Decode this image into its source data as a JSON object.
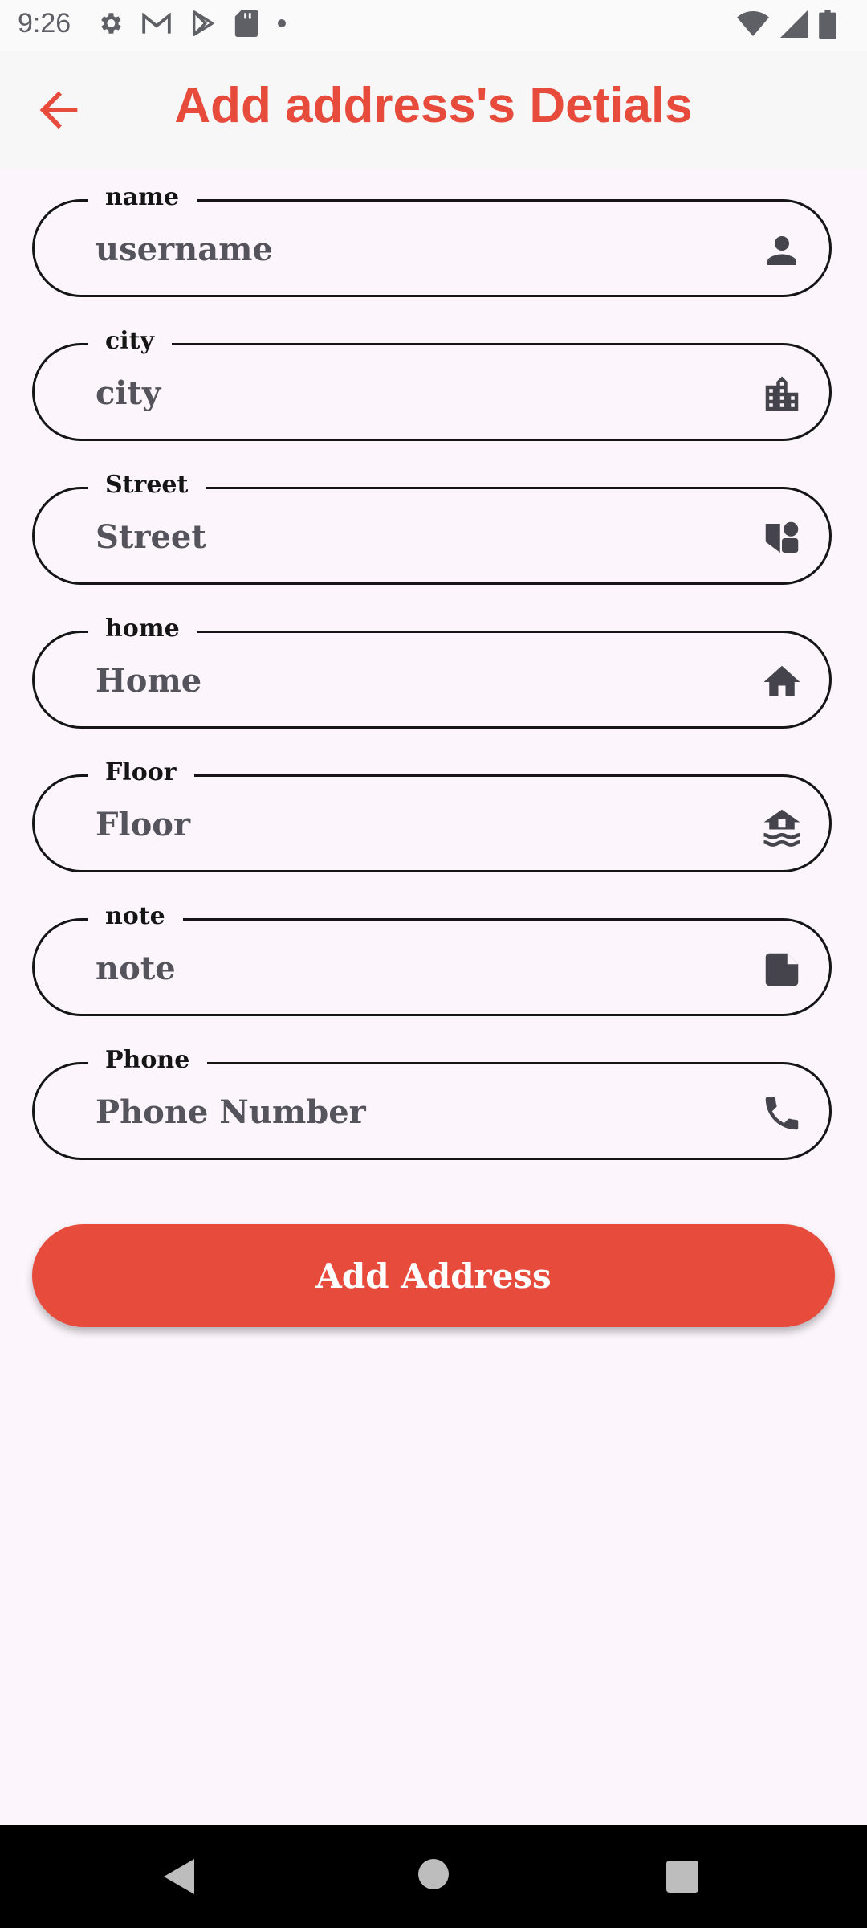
{
  "status_bar": {
    "time": "9:26",
    "left_icons": [
      "gear-icon",
      "gmail-icon",
      "play-store-icon",
      "sd-card-icon",
      "dot-icon"
    ],
    "right_icons": [
      "wifi-icon",
      "signal-icon",
      "battery-icon"
    ]
  },
  "app_bar": {
    "back_icon": "arrow-back-icon",
    "title": "Add address's Detials",
    "accent_color": "#e64b3c"
  },
  "fields": [
    {
      "label": "name",
      "placeholder": "username",
      "value": "",
      "icon": "person-icon"
    },
    {
      "label": "city",
      "placeholder": "city",
      "value": "",
      "icon": "city-building-icon"
    },
    {
      "label": "Street",
      "placeholder": "Street",
      "value": "",
      "icon": "shapes-icon"
    },
    {
      "label": "home",
      "placeholder": "Home",
      "value": "",
      "icon": "home-icon"
    },
    {
      "label": "Floor",
      "placeholder": "Floor",
      "value": "",
      "icon": "house-flood-icon"
    },
    {
      "label": "note",
      "placeholder": "note",
      "value": "",
      "icon": "sticky-note-icon"
    },
    {
      "label": "Phone",
      "placeholder": "Phone Number",
      "value": "",
      "icon": "phone-icon"
    }
  ],
  "submit": {
    "label": "Add Address"
  },
  "nav_bar": {
    "icons": [
      "nav-back-icon",
      "nav-home-icon",
      "nav-recents-icon"
    ]
  }
}
